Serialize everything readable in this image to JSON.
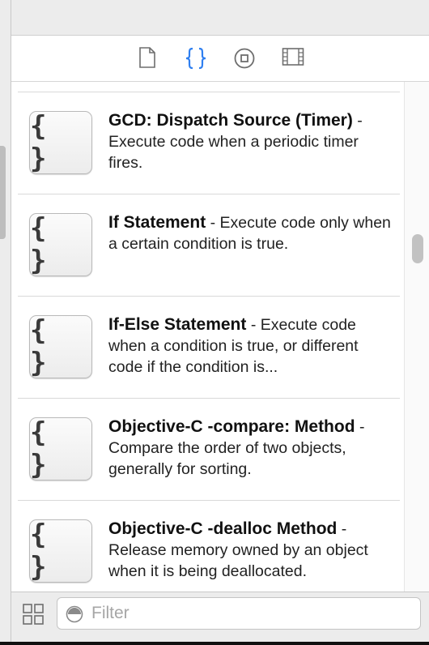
{
  "library_tabs": [
    {
      "name": "file-template-library",
      "icon": "document-icon",
      "selected": false
    },
    {
      "name": "code-snippet-library",
      "icon": "braces-icon",
      "selected": true
    },
    {
      "name": "object-library",
      "icon": "circle-square-icon",
      "selected": false
    },
    {
      "name": "media-library",
      "icon": "film-strip-icon",
      "selected": false
    }
  ],
  "snippet_icon_glyph": "{ }",
  "snippets": [
    {
      "title": "GCD: Dispatch Source (Timer)",
      "description": "- Execute code when a periodic timer fires."
    },
    {
      "title": "If Statement",
      "description": "- Execute code only when a certain condition is true."
    },
    {
      "title": "If-Else Statement",
      "description": "- Execute code when a condition is true, or different code if the condition is..."
    },
    {
      "title": "Objective-C -compare: Method",
      "description": "- Compare the order of two objects, generally for sorting."
    },
    {
      "title": "Objective-C -dealloc Method",
      "description": "- Release memory owned by an object when it is being deallocated."
    }
  ],
  "filter": {
    "placeholder": "Filter",
    "value": ""
  },
  "colors": {
    "accent": "#2f7ff0",
    "icon_gray": "#6e6e6e"
  }
}
